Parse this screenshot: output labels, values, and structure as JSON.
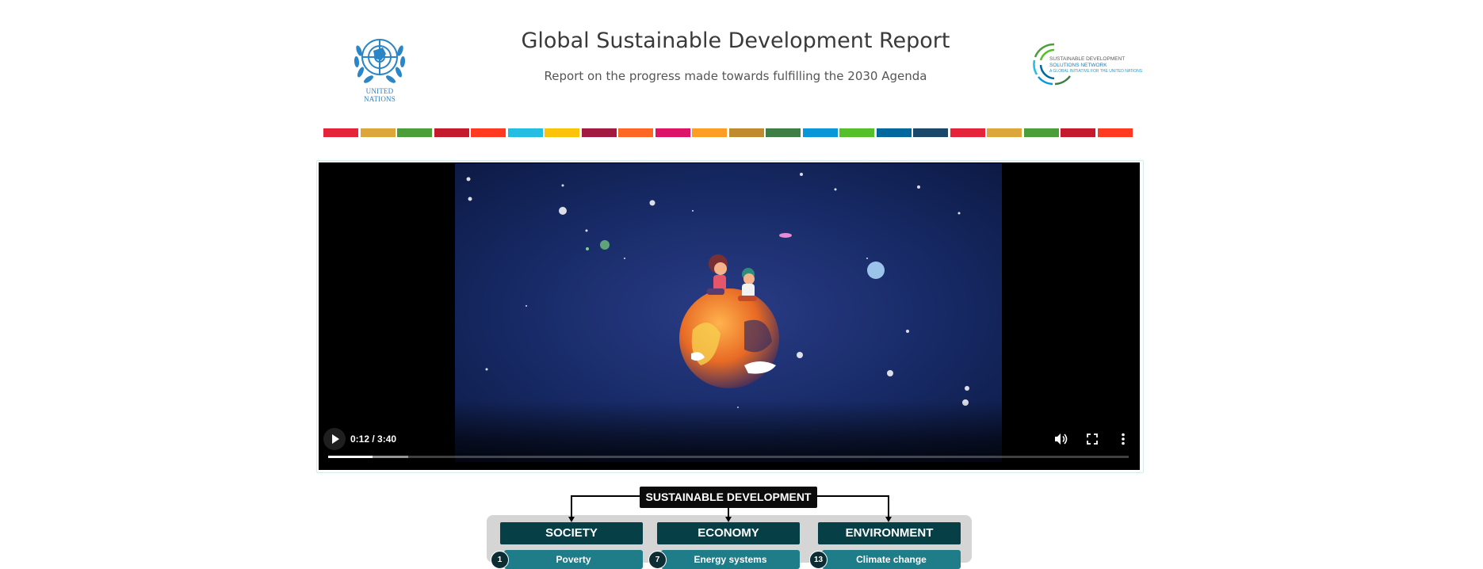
{
  "header": {
    "title": "Global Sustainable Development Report",
    "subtitle": "Report on the progress made towards fulfilling the 2030 Agenda",
    "un_logo_text": "UNITED NATIONS",
    "sdsn_logo": {
      "line1": "SUSTAINABLE DEVELOPMENT",
      "line2": "SOLUTIONS NETWORK",
      "line3": "A GLOBAL INITIATIVE FOR THE UNITED NATIONS"
    }
  },
  "sdg_strip_colors": [
    "#e5243b",
    "#dda63a",
    "#4c9f38",
    "#c5192d",
    "#ff3a21",
    "#26bde2",
    "#fcc30b",
    "#a21942",
    "#fd6925",
    "#dd1367",
    "#fd9d24",
    "#bf8b2e",
    "#3f7e44",
    "#0a97d9",
    "#56c02b",
    "#00689d",
    "#19486a",
    "#e5243b",
    "#dda63a",
    "#4c9f38",
    "#c5192d",
    "#ff3a21"
  ],
  "video": {
    "time": "0:12 / 3:40",
    "played_fraction": 0.055,
    "buffered_fraction": 0.1,
    "icons": [
      "play-icon",
      "volume-icon",
      "fullscreen-icon",
      "more-vertical-icon"
    ]
  },
  "diagram": {
    "title": "SUSTAINABLE DEVELOPMENT",
    "pillars": [
      "SOCIETY",
      "ECONOMY",
      "ENVIRONMENT"
    ],
    "items": [
      {
        "num": "1",
        "label": "Poverty"
      },
      {
        "num": "7",
        "label": "Energy systems"
      },
      {
        "num": "13",
        "label": "Climate change"
      }
    ]
  },
  "colors": {
    "video_bg": "#0f1f4f",
    "pillar": "#063f46",
    "subitem": "#1e7d89"
  }
}
